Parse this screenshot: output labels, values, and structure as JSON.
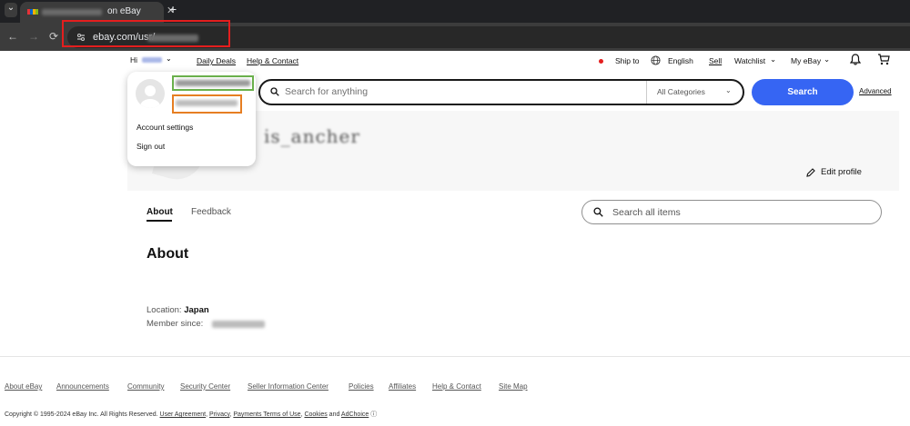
{
  "browser": {
    "tab_title": "on eBay",
    "url": "ebay.com/usr/",
    "new_tab_label": "+",
    "close_label": "✕",
    "tab_list_label": "⌄",
    "back_label": "←",
    "forward_label": "→",
    "reload_label": "⟳"
  },
  "topnav": {
    "greeting": "Hi",
    "daily_deals": "Daily Deals",
    "help_contact": "Help & Contact",
    "ship_to": "Ship to",
    "language": "English",
    "sell": "Sell",
    "watchlist": "Watchlist",
    "my_ebay": "My eBay",
    "chevron": "⌄"
  },
  "search": {
    "placeholder": "Search for anything",
    "category": "All Categories",
    "button": "Search",
    "advanced": "Advanced"
  },
  "account_menu": {
    "settings": "Account settings",
    "sign_out": "Sign out"
  },
  "profile": {
    "username_scribble": "is_ancher",
    "edit_profile": "Edit profile",
    "tabs": [
      "About",
      "Feedback"
    ],
    "items_search_placeholder": "Search all items",
    "about_heading": "About",
    "location_label": "Location:",
    "location_value": "Japan",
    "member_since_label": "Member since:"
  },
  "footer": {
    "links": [
      "About eBay",
      "Announcements",
      "Community",
      "Security Center",
      "Seller Information Center",
      "Policies",
      "Affiliates",
      "Help & Contact",
      "Site Map"
    ],
    "copyright": "Copyright © 1995-2024 eBay Inc. All Rights Reserved.",
    "legal_links": [
      "User Agreement",
      "Privacy",
      "Payments Terms of Use",
      "Cookies",
      "AdChoice"
    ]
  },
  "colors": {
    "accent": "#3665f3",
    "highlight_red": "#e41e1e",
    "highlight_green": "#6ab04c",
    "highlight_orange": "#e67e22"
  }
}
